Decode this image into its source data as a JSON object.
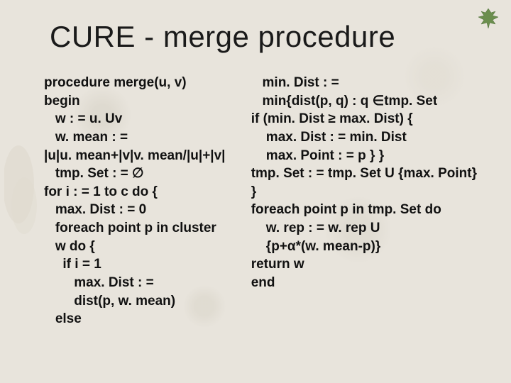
{
  "title": "CURE - merge procedure",
  "left": {
    "l0": "procedure merge(u, v)",
    "l1": "begin",
    "l2": "   w : = u. Uv",
    "l3": "   w. mean : =",
    "l4": "|u|u. mean+|v|v. mean/|u|+|v|",
    "l5": "   tmp. Set : = ∅",
    "l6": "for i : = 1 to c do {",
    "l7": "   max. Dist : = 0",
    "l8": "   foreach point p in cluster",
    "l9": "   w do {",
    "l10": "     if i = 1",
    "l11": "        max. Dist : =",
    "l12": "        dist(p, w. mean)",
    "l13": "   else"
  },
  "right": {
    "r0": "   min. Dist : =",
    "r1": "   min{dist(p, q) : q ∈tmp. Set",
    "r2": "if (min. Dist ≥ max. Dist) {",
    "r3": "    max. Dist : = min. Dist",
    "r4": "    max. Point : = p } }",
    "r5": "tmp. Set : = tmp. Set U {max. Point}",
    "r6": "}",
    "r7": "foreach point p in tmp. Set do",
    "r8": "    w. rep : = w. rep U",
    "r9": "    {p+α*(w. mean-p)}",
    "r10": "return w",
    "r11": "end"
  },
  "icons": {
    "leaf": "leaf-icon"
  }
}
